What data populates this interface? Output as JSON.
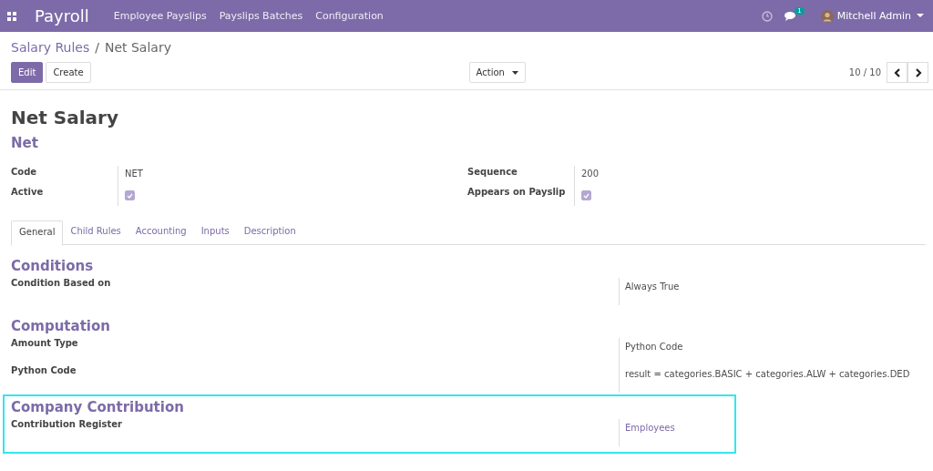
{
  "navbar": {
    "app": "Payroll",
    "menu": [
      "Employee Payslips",
      "Payslips Batches",
      "Configuration"
    ],
    "message_count": "1",
    "user": "Mitchell Admin"
  },
  "breadcrumb": {
    "parent": "Salary Rules",
    "separator": "/",
    "current": "Net Salary"
  },
  "buttons": {
    "edit": "Edit",
    "create": "Create",
    "action": "Action"
  },
  "pager": "10 / 10",
  "record": {
    "title": "Net Salary",
    "category": "Net"
  },
  "fields_left": [
    {
      "label": "Code",
      "kind": "text",
      "value": "NET"
    },
    {
      "label": "Active",
      "kind": "checkbox",
      "checked": true
    }
  ],
  "fields_right": [
    {
      "label": "Sequence",
      "kind": "text",
      "value": "200"
    },
    {
      "label": "Appears on Payslip",
      "kind": "checkbox",
      "checked": true
    }
  ],
  "tabs": [
    {
      "label": "General",
      "selected": true
    },
    {
      "label": "Child Rules",
      "selected": false
    },
    {
      "label": "Accounting",
      "selected": false
    },
    {
      "label": "Inputs",
      "selected": false
    },
    {
      "label": "Description",
      "selected": false
    }
  ],
  "sections": [
    {
      "title": "Conditions",
      "highlighted": false,
      "fields": [
        {
          "label": "Condition Based on",
          "value": "Always True",
          "kind": "text"
        }
      ]
    },
    {
      "title": "Computation",
      "highlighted": false,
      "fields": [
        {
          "label": "Amount Type",
          "value": "Python Code",
          "kind": "text"
        },
        {
          "label": "Python Code",
          "value": "result = categories.BASIC + categories.ALW + categories.DED",
          "kind": "text"
        }
      ]
    },
    {
      "title": "Company Contribution",
      "highlighted": true,
      "fields": [
        {
          "label": "Contribution Register",
          "value": "Employees",
          "kind": "link"
        }
      ]
    }
  ]
}
